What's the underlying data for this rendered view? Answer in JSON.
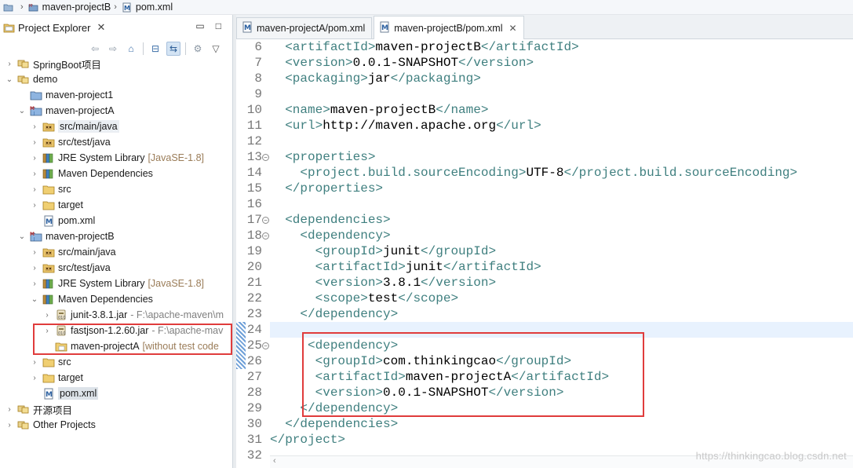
{
  "breadcrumb": {
    "project": "maven-projectB",
    "file": "pom.xml"
  },
  "explorer": {
    "title": "Project Explorer",
    "close": "✕",
    "tree": [
      {
        "depth": 0,
        "arrow": "›",
        "icon": "working-set-icon",
        "label": "SpringBoot项目"
      },
      {
        "depth": 0,
        "arrow": "⌄",
        "icon": "working-set-icon",
        "label": "demo"
      },
      {
        "depth": 1,
        "arrow": "",
        "icon": "project-icon",
        "label": "maven-project1"
      },
      {
        "depth": 1,
        "arrow": "⌄",
        "icon": "maven-project-icon",
        "label": "maven-projectA"
      },
      {
        "depth": 2,
        "arrow": "›",
        "icon": "source-folder-icon",
        "label": "src/main/java",
        "state": "hilite"
      },
      {
        "depth": 2,
        "arrow": "›",
        "icon": "source-folder-icon",
        "label": "src/test/java"
      },
      {
        "depth": 2,
        "arrow": "›",
        "icon": "library-icon",
        "label": "JRE System Library",
        "deco": "[JavaSE-1.8]"
      },
      {
        "depth": 2,
        "arrow": "›",
        "icon": "library-icon",
        "label": "Maven Dependencies"
      },
      {
        "depth": 2,
        "arrow": "›",
        "icon": "folder-icon",
        "label": "src"
      },
      {
        "depth": 2,
        "arrow": "›",
        "icon": "folder-icon",
        "label": "target"
      },
      {
        "depth": 2,
        "arrow": "",
        "icon": "pom-file-icon",
        "label": "pom.xml"
      },
      {
        "depth": 1,
        "arrow": "⌄",
        "icon": "maven-project-icon",
        "label": "maven-projectB"
      },
      {
        "depth": 2,
        "arrow": "›",
        "icon": "source-folder-icon",
        "label": "src/main/java"
      },
      {
        "depth": 2,
        "arrow": "›",
        "icon": "source-folder-icon",
        "label": "src/test/java"
      },
      {
        "depth": 2,
        "arrow": "›",
        "icon": "library-icon",
        "label": "JRE System Library",
        "deco": "[JavaSE-1.8]"
      },
      {
        "depth": 2,
        "arrow": "⌄",
        "icon": "library-icon",
        "label": "Maven Dependencies"
      },
      {
        "depth": 3,
        "arrow": "›",
        "icon": "jar-icon",
        "label": "junit-3.8.1.jar",
        "deco": "- F:\\apache-maven\\m",
        "decoStyle": "gray"
      },
      {
        "depth": 3,
        "arrow": "›",
        "icon": "jar-icon",
        "label": "fastjson-1.2.60.jar",
        "deco": "- F:\\apache-mav",
        "decoStyle": "gray"
      },
      {
        "depth": 3,
        "arrow": "",
        "icon": "project-folder-icon",
        "label": "maven-projectA",
        "deco": "[without test code"
      },
      {
        "depth": 2,
        "arrow": "›",
        "icon": "folder-icon",
        "label": "src"
      },
      {
        "depth": 2,
        "arrow": "›",
        "icon": "folder-icon",
        "label": "target"
      },
      {
        "depth": 2,
        "arrow": "",
        "icon": "pom-file-icon",
        "label": "pom.xml",
        "state": "selected"
      },
      {
        "depth": 0,
        "arrow": "›",
        "icon": "working-set-icon",
        "label": "开源项目"
      },
      {
        "depth": 0,
        "arrow": "›",
        "icon": "working-set-icon",
        "label": "Other Projects"
      }
    ]
  },
  "editor": {
    "tabs": [
      {
        "label": "maven-projectA/pom.xml",
        "active": false
      },
      {
        "label": "maven-projectB/pom.xml",
        "active": true
      }
    ],
    "lines": [
      {
        "n": "6",
        "text": "  <artifactId>maven-projectB</artifactId>"
      },
      {
        "n": "7",
        "text": "  <version>0.0.1-SNAPSHOT</version>"
      },
      {
        "n": "8",
        "text": "  <packaging>jar</packaging>"
      },
      {
        "n": "9",
        "text": ""
      },
      {
        "n": "10",
        "text": "  <name>maven-projectB</name>"
      },
      {
        "n": "11",
        "text": "  <url>http://maven.apache.org</url>"
      },
      {
        "n": "12",
        "text": ""
      },
      {
        "n": "13",
        "text": "  <properties>",
        "fold": true
      },
      {
        "n": "14",
        "text": "    <project.build.sourceEncoding>UTF-8</project.build.sourceEncoding>"
      },
      {
        "n": "15",
        "text": "  </properties>"
      },
      {
        "n": "16",
        "text": ""
      },
      {
        "n": "17",
        "text": "  <dependencies>",
        "fold": true
      },
      {
        "n": "18",
        "text": "    <dependency>",
        "fold": true
      },
      {
        "n": "19",
        "text": "      <groupId>junit</groupId>"
      },
      {
        "n": "20",
        "text": "      <artifactId>junit</artifactId>"
      },
      {
        "n": "21",
        "text": "      <version>3.8.1</version>"
      },
      {
        "n": "22",
        "text": "      <scope>test</scope>"
      },
      {
        "n": "23",
        "text": "    </dependency>"
      },
      {
        "n": "24",
        "text": ""
      },
      {
        "n": "25",
        "text": "     <dependency>",
        "fold": true
      },
      {
        "n": "26",
        "text": "      <groupId>com.thinkingcao</groupId>"
      },
      {
        "n": "27",
        "text": "      <artifactId>maven-projectA</artifactId>"
      },
      {
        "n": "28",
        "text": "      <version>0.0.1-SNAPSHOT</version>"
      },
      {
        "n": "29",
        "text": "    </dependency>"
      },
      {
        "n": "30",
        "text": "  </dependencies>"
      },
      {
        "n": "31",
        "text": "</project>"
      },
      {
        "n": "32",
        "text": ""
      }
    ]
  },
  "watermark": "https://thinkingcao.blog.csdn.net",
  "colors": {
    "tag": "#3f7f7f",
    "text": "#000000",
    "highlight_box": "#e03c3c",
    "current_line": "#e8f2fe"
  }
}
